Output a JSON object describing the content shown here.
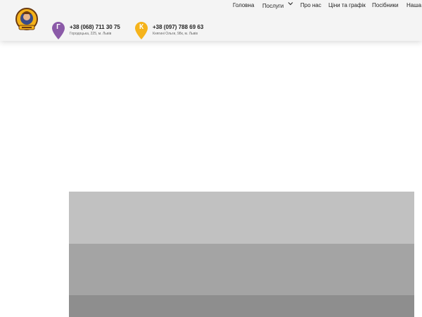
{
  "header": {
    "contacts": [
      {
        "letter": "Г",
        "phone": "+38 (068) 711 30 75",
        "address": "Городоцька, 225, м. Львів",
        "color": "#8b5aa8"
      },
      {
        "letter": "К",
        "phone": "+38 (097) 788 69 63",
        "address": "Княгині Ольги, 98к, м. Львів",
        "color": "#f5b31b"
      }
    ]
  },
  "nav": {
    "items": [
      {
        "label": "Головна"
      },
      {
        "label": "Послуги",
        "dropdown": true
      },
      {
        "label": "Про нас"
      },
      {
        "label": "Ціни та графік"
      },
      {
        "label": "Посібники"
      },
      {
        "label": "Наша"
      }
    ]
  },
  "banner": {
    "bands": [
      "#c1c1c1",
      "#a4a4a4",
      "#8e8e8e"
    ]
  }
}
